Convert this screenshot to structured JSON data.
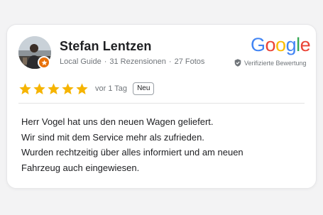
{
  "reviewer": {
    "name": "Stefan Lentzen",
    "level": "Local Guide",
    "reviews": "31 Rezensionen",
    "photos": "27 Fotos"
  },
  "brand": {
    "logo_text": "Google",
    "verified_label": "Verifizierte Bewertung"
  },
  "rating": {
    "stars": 5,
    "max_stars": 5,
    "time": "vor 1 Tag",
    "badge": "Neu"
  },
  "review": {
    "lines": [
      "Herr Vogel hat uns den neuen Wagen geliefert.",
      "Wir sind mit dem Service mehr als zufrieden.",
      "Wurden rechtzeitig über alles informiert und am neuen",
      "Fahrzeug auch eingewiesen."
    ]
  },
  "colors": {
    "star": "#f6b400",
    "badge_orange": "#e8710a",
    "google_blue": "#4285f4",
    "google_red": "#ea4335",
    "google_yellow": "#fbbc05",
    "google_green": "#34a853"
  }
}
